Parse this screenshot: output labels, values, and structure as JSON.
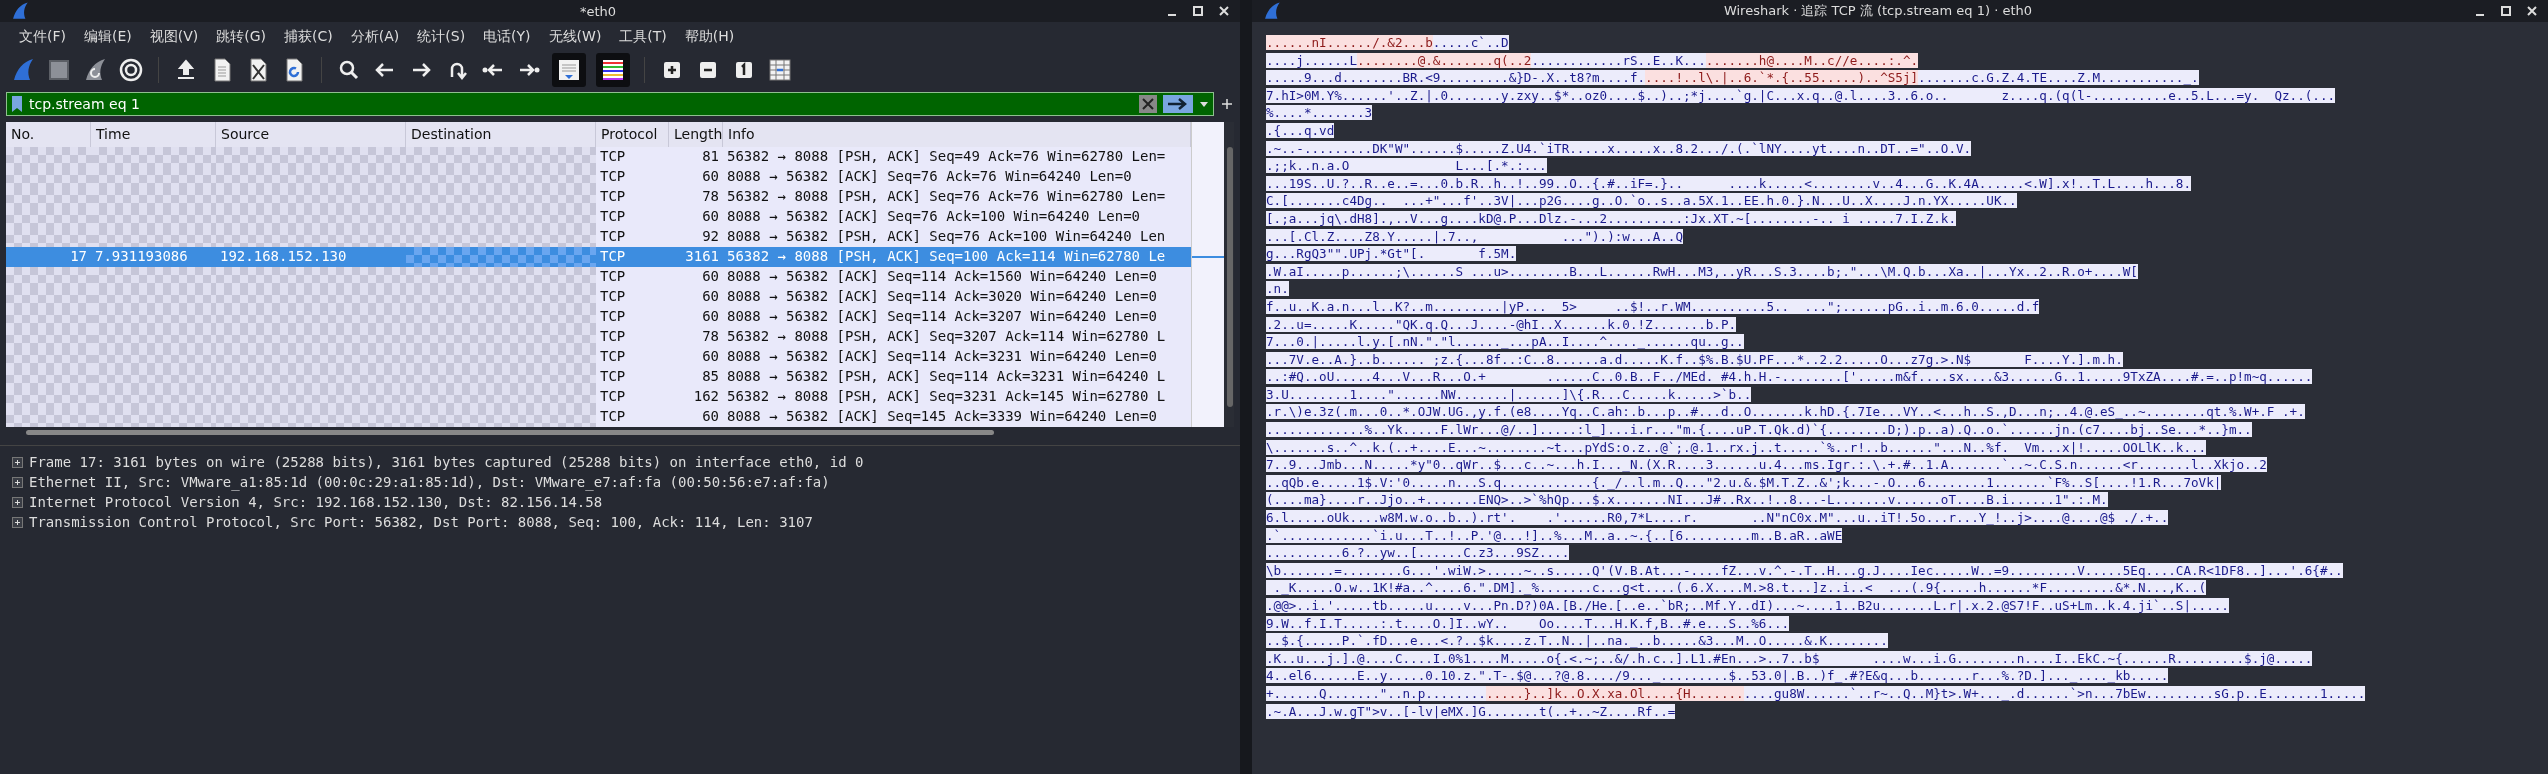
{
  "main_window": {
    "title": "*eth0",
    "menu": [
      "文件(F)",
      "编辑(E)",
      "视图(V)",
      "跳转(G)",
      "捕获(C)",
      "分析(A)",
      "统计(S)",
      "电话(Y)",
      "无线(W)",
      "工具(T)",
      "帮助(H)"
    ],
    "filter": {
      "value": "tcp.stream eq 1"
    },
    "packet_list": {
      "columns": [
        "No.",
        "Time",
        "Source",
        "Destination",
        "Protocol",
        "Length",
        "Info"
      ],
      "rows": [
        {
          "protocol": "TCP",
          "length": "81",
          "info": "56382 → 8088 [PSH, ACK] Seq=49 Ack=76 Win=62780 Len=",
          "selected": false
        },
        {
          "protocol": "TCP",
          "length": "60",
          "info": "8088 → 56382 [ACK] Seq=76 Ack=76 Win=64240 Len=0",
          "selected": false
        },
        {
          "protocol": "TCP",
          "length": "78",
          "info": "56382 → 8088 [PSH, ACK] Seq=76 Ack=76 Win=62780 Len=",
          "selected": false
        },
        {
          "protocol": "TCP",
          "length": "60",
          "info": "8088 → 56382 [ACK] Seq=76 Ack=100 Win=64240 Len=0",
          "selected": false
        },
        {
          "protocol": "TCP",
          "length": "92",
          "info": "8088 → 56382 [PSH, ACK] Seq=76 Ack=100 Win=64240 Len",
          "selected": false
        },
        {
          "no": "17",
          "time": "7.931193086",
          "source": "192.168.152.130",
          "protocol": "TCP",
          "length": "3161",
          "info": "56382 → 8088 [PSH, ACK] Seq=100 Ack=114 Win=62780 Le",
          "selected": true
        },
        {
          "protocol": "TCP",
          "length": "60",
          "info": "8088 → 56382 [ACK] Seq=114 Ack=1560 Win=64240 Len=0",
          "selected": false
        },
        {
          "protocol": "TCP",
          "length": "60",
          "info": "8088 → 56382 [ACK] Seq=114 Ack=3020 Win=64240 Len=0",
          "selected": false
        },
        {
          "protocol": "TCP",
          "length": "60",
          "info": "8088 → 56382 [ACK] Seq=114 Ack=3207 Win=64240 Len=0",
          "selected": false
        },
        {
          "protocol": "TCP",
          "length": "78",
          "info": "56382 → 8088 [PSH, ACK] Seq=3207 Ack=114 Win=62780 L",
          "selected": false
        },
        {
          "protocol": "TCP",
          "length": "60",
          "info": "8088 → 56382 [ACK] Seq=114 Ack=3231 Win=64240 Len=0",
          "selected": false
        },
        {
          "protocol": "TCP",
          "length": "85",
          "info": "8088 → 56382 [PSH, ACK] Seq=114 Ack=3231 Win=64240 L",
          "selected": false
        },
        {
          "protocol": "TCP",
          "length": "162",
          "info": "56382 → 8088 [PSH, ACK] Seq=3231 Ack=145 Win=62780 L",
          "selected": false
        },
        {
          "protocol": "TCP",
          "length": "60",
          "info": "8088 → 56382 [ACK] Seq=145 Ack=3339 Win=64240 Len=0",
          "selected": false
        }
      ]
    },
    "details": [
      {
        "text": "Frame 17: 3161 bytes on wire (25288 bits), 3161 bytes captured (25288 bits) on interface eth0, id 0",
        "expanded": false
      },
      {
        "text": "Ethernet II, Src: VMware_a1:85:1d (00:0c:29:a1:85:1d), Dst: VMware_e7:af:fa (00:50:56:e7:af:fa)",
        "expanded": false
      },
      {
        "text": "Internet Protocol Version 4, Src: 192.168.152.130, Dst: 82.156.14.58",
        "expanded": false
      },
      {
        "text": "Transmission Control Protocol, Src Port: 56382, Dst Port: 8088, Seq: 100, Ack: 114, Len: 3107",
        "expanded": false
      }
    ]
  },
  "stream_window": {
    "title": "Wireshark · 追踪 TCP 流 (tcp.stream eq 1) · eth0",
    "lines": [
      {
        "segments": [
          {
            "kind": "server",
            "text": "......nI....../.&2...b"
          },
          {
            "kind": "client",
            "text": ".....c`..D"
          }
        ]
      },
      {
        "segments": [
          {
            "kind": "client",
            "text": "....j......L"
          },
          {
            "kind": "server",
            "text": "........@.&.......q(..2"
          },
          {
            "kind": "client",
            "text": "............rS..E..K..."
          },
          {
            "kind": "server",
            "text": ".......h@....M..c//e....:.^."
          }
        ]
      },
      {
        "segments": [
          {
            "kind": "client",
            "text": ".....9...d........BR.<9.........&}D-.X..t8?m....f."
          },
          {
            "kind": "server",
            "text": "....!..l\\.|..6.`*.{..55.....)..^S5j]"
          },
          {
            "kind": "client",
            "text": ".......c.G.Z.4.TE....Z.M..........._."
          }
        ]
      },
      {
        "segments": [
          {
            "kind": "client",
            "text": "7.hI>0M.Y%......'..Z.|.0.......y.zxy..$*..oz0....$..)..;*j....`g.|C...x.q..@.l....3..6.o..       z....q.(q(l-..........e..5.L...=y.  Qz..(..."
          }
        ]
      },
      {
        "segments": [
          {
            "kind": "client",
            "text": "%....*.......3"
          }
        ]
      },
      {
        "segments": [
          {
            "kind": "client",
            "text": ".{...q.vd"
          }
        ]
      },
      {
        "segments": [
          {
            "kind": "client",
            "text": ".~..-.........DK\"W\"......$.....Z.U4.`iTR.....x.....x..8.2.../.(.`lNY....yt....n..DT..=\"..O.V."
          }
        ]
      },
      {
        "segments": [
          {
            "kind": "client",
            "text": ".;;k..n.a.O              L...[.*.:..."
          }
        ]
      },
      {
        "segments": [
          {
            "kind": "client",
            "text": "...19S..U.?..R..e..=...0.b.R..h..!..99..O..{.#..iF=.}..      ....k.....<........v..4...G..K.4A......<.W].x!..T.L....h...8."
          }
        ]
      },
      {
        "segments": [
          {
            "kind": "client",
            "text": "C.[.......c4Dg..  ...+\"...f'..3V|...p2G....g..O.`o..s..a.5X.1..EE.h.0.}.N...U..X....J.n.YX.....UK.."
          }
        ]
      },
      {
        "segments": [
          {
            "kind": "client",
            "text": "[.;a...jq\\.dH8].,..V...g....kD@.P...Dlz.-...2..........:Jx.XT.~[........-.. i .....7.I.Z.k."
          }
        ]
      },
      {
        "segments": [
          {
            "kind": "client",
            "text": "...[.Cl.Z....Z8.Y.....|.7..,           ...\").):w...A..Q"
          }
        ]
      },
      {
        "segments": [
          {
            "kind": "client",
            "text": "g...RgQ3\"\".UPj.*Gt\"[.       f.5M."
          }
        ]
      },
      {
        "segments": [
          {
            "kind": "client",
            "text": ".W.aI.....p......;\\......S ...u>........B...L......RwH...M3,..yR...S.3....b;.\"...\\M.Q.b...Xa..|...Yx..2..R.o+....W["
          }
        ]
      },
      {
        "segments": [
          {
            "kind": "client",
            "text": ".n."
          }
        ]
      },
      {
        "segments": [
          {
            "kind": "client",
            "text": "f..u..K.a.n...l..K?..m.........|yP...  5>     ..$!..r.WM..........5..  ...\";......pG..i..m.6.0.....d.f"
          }
        ]
      },
      {
        "segments": [
          {
            "kind": "client",
            "text": ".2..u=.....K.....\"QK.q.Q...J....-@hI..X......k.0.!Z.......b.P."
          }
        ]
      },
      {
        "segments": [
          {
            "kind": "client",
            "text": "7...0.|.....l.y.[.nN.\".\"l......_...pA..I....^...._......qu..g.."
          }
        ]
      },
      {
        "segments": [
          {
            "kind": "client",
            "text": "...7V.e..A.}..b...... ;z.{...8f..:C..8......a.d.....K.f..$%.B.$U.PF...*..2.2.....O...z7g.>.N$       F....Y.].m.h."
          }
        ]
      },
      {
        "segments": [
          {
            "kind": "client",
            "text": "..:#Q..oU.....4...V...R...O.+        ......C..0.B..F../MEd. #4.h.H.-........['.....m&f....sx....&3......G..1.....9TxZA....#.=..p!m~q......"
          }
        ]
      },
      {
        "segments": [
          {
            "kind": "client",
            "text": "3.U........1....\"......NW.......|......]\\{.R...C.....k.....>`b.."
          }
        ]
      },
      {
        "segments": [
          {
            "kind": "client",
            "text": ".r.\\)e.3z(.m...0..*.OJW.UG.,y.f.(e8....Yq..C.ah:.b...p..#...d..O.......k.hD.{.7Ie...VY..<...h..S.,D...n;..4.@.eS_..~........qt.%.W+.F .+."
          }
        ]
      },
      {
        "segments": [
          {
            "kind": "client",
            "text": ".............%..Yk.....F.lWr...@/..].....:l_]...i.r...\"m.{....uP.T.Qk.d)`{........D;).p..a).Q..o.`......jn.(c7....bj..Se...*..}m.."
          }
        ]
      },
      {
        "segments": [
          {
            "kind": "client",
            "text": "\\.......s..^..k.(..+....E...~........~t...pYdS:o.z..@`;.@.1..rx.j..t.....`%..r!..b......\"...N..%f.  Vm...x|!.....OOLlK..k..."
          }
        ]
      },
      {
        "segments": [
          {
            "kind": "client",
            "text": "7..9...Jmb...N.....*y\"0..qWr..$...c..~...h.I..._N.(X.R....3......u.4...ms.Igr.:.\\.+.#..1.A.......`..~.C.S.n......<r.......l..Xkjo..2"
          }
        ]
      },
      {
        "segments": [
          {
            "kind": "client",
            "text": "..qQb.e.....1$.V:'0.....n...S.q............{._/..l.m..Q...\"2.u.&.$M.T.Z..&';k...-.O...6........1.......`F%..S[....!1.R...7oVk|"
          }
        ]
      },
      {
        "segments": [
          {
            "kind": "client",
            "text": "(....ma}....r..Jjo..+.......ENQ>..>`%hQp...$.x.......NI...J#..Rx..!..8...-L.......v......oT....B.i......1\".:.M."
          }
        ]
      },
      {
        "segments": [
          {
            "kind": "client",
            "text": "6.l.....oUk....w8M.w.o..b..).rt'.    .'......R0,7*L....r.       ..N\"nC0x.M\"...u..iT!.5o...r...Y_!..j>....@....@$ ./.+.."
          }
        ]
      },
      {
        "segments": [
          {
            "kind": "client",
            "text": ".`............`i.u...T..!..P.'@...!]..%...M..a..~.{..[6.........m..B.aR..aWE"
          }
        ]
      },
      {
        "segments": [
          {
            "kind": "client",
            "text": "..........6.?..yw..[......C.z3...9SZ...."
          }
        ]
      },
      {
        "segments": [
          {
            "kind": "client",
            "text": "\\b.......=........G...'.wiW.>.....~..s.....Q'(V.B.At...-....fZ...v.^.-.T..H...g.J....Iec.....W..=9.........V.....5Eq....CA.R<1DF8..]...'.6{#.."
          }
        ]
      },
      {
        "segments": [
          {
            "kind": "client",
            "text": " ._K.....O.w..1K!#a..^....6.\".DM]._%.......c...g<t....(.6.X....M.>8.t...]z..i..<  ...(.9{.....h......*F.........&*.N...,K..("
          }
        ]
      },
      {
        "segments": [
          {
            "kind": "client",
            "text": ".@@>..i.'.....tb.....u....v...Pn.D?)0A.[B./He.[..e..`bR;..Mf.Y..dI)...~....1..B2u.......L.r|.x.2.@S7!F..uS+Lm..k.4.ji`..S|....."
          }
        ]
      },
      {
        "segments": [
          {
            "kind": "client",
            "text": "9.W..f.I.T.....:.t....O.]I..wY..    Oo....T...H.K.f,B..#.e...S..%6..."
          }
        ]
      },
      {
        "segments": [
          {
            "kind": "client",
            "text": "..$.{.....P.`.fD...e...<.?..$k....z.T..N..|..na._..b.....&3...M..O.....&.K........"
          }
        ]
      },
      {
        "segments": [
          {
            "kind": "client",
            "text": ".K..u...j.].@....C....I.0%1....M.....o{.<.~;..&/.h.c..].L1.#En...>..7..b$       ....w...i.G........n....I..EkC.~{......R.........$.j@....."
          }
        ]
      },
      {
        "segments": [
          {
            "kind": "client",
            "text": "4..el6......E..y.....0.10.z.\".T-.$@...?@.8..../9..._.........$..53.0|.B..)f_.#?E&q...b.......r...%.?D.]..._...._kb....."
          }
        ]
      },
      {
        "segments": [
          {
            "kind": "client",
            "text": "+......Q.......\"..n.p........"
          },
          {
            "kind": "server",
            "text": ".....}..]k..O.X.xa.Ol....{H......."
          },
          {
            "kind": "client",
            "text": "....gu8W......`..r~..Q..M}t>.W+..._.d......`>n...7bEw.........sG.p..E.......1....."
          }
        ]
      },
      {
        "segments": [
          {
            "kind": "client",
            "text": ".~.A...J.w.gT\">v..[-lv|eMX.]G.......t(..+..~Z....Rf..="
          }
        ]
      }
    ]
  }
}
